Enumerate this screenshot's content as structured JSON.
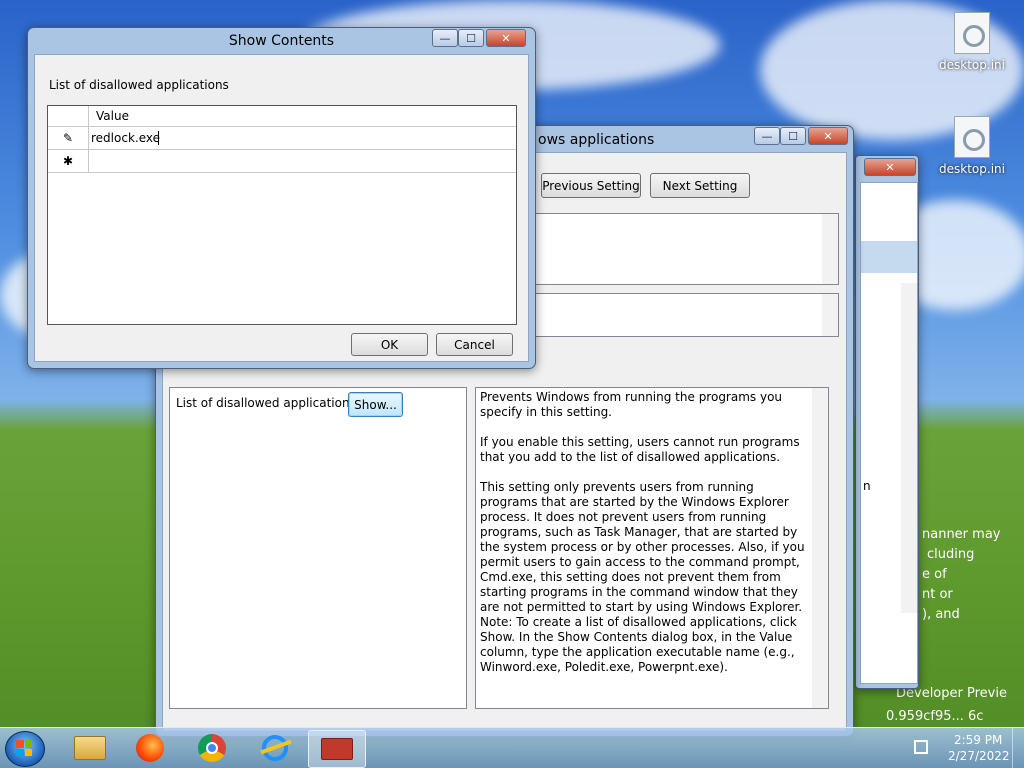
{
  "desktop": {
    "icons": [
      {
        "label": "desktop.ini"
      },
      {
        "label": "desktop.ini"
      }
    ],
    "bg_text": [
      "nanner may",
      "cluding",
      "e of",
      "nt or",
      "), and",
      "Developer Previe",
      "0.959cf95... 6c"
    ]
  },
  "gp_window": {
    "title_fragment": "ows applications",
    "prev_button": "Previous Setting",
    "next_button": "Next Setting",
    "option_label": "List of disallowed applications",
    "show_button": "Show...",
    "help_paragraphs": [
      "Prevents Windows from running the programs you specify in this setting.",
      "If you enable this setting, users cannot run programs that you add to the list of disallowed applications.",
      "This setting only prevents users from running programs that are started by the Windows Explorer process. It does not prevent users from running programs, such as Task Manager, that are started by the system process or by other processes. Also, if you permit users to gain access to the command prompt, Cmd.exe, this setting does not prevent them from starting programs in the command window that they are not permitted to start by using Windows Explorer. Note: To create a list of disallowed applications, click Show. In the Show Contents dialog box, in the Value column, type the application executable name (e.g., Winword.exe, Poledit.exe, Powerpnt.exe)."
    ],
    "side_fragment": "n"
  },
  "dialog": {
    "title": "Show Contents",
    "heading": "List of disallowed applications",
    "column_header": "Value",
    "rows": [
      {
        "marker": "✎",
        "value": "redlock.exe"
      },
      {
        "marker": "✱",
        "value": ""
      }
    ],
    "ok": "OK",
    "cancel": "Cancel"
  },
  "taskbar": {
    "time": "2:59 PM",
    "date": "2/27/2022",
    "apps": [
      "file-explorer-icon",
      "firefox-icon",
      "chrome-icon",
      "ie-icon",
      "control-panel-icon"
    ]
  },
  "colors": {
    "accent": "#3c7fb1",
    "title_bar": "#aac4e3"
  }
}
